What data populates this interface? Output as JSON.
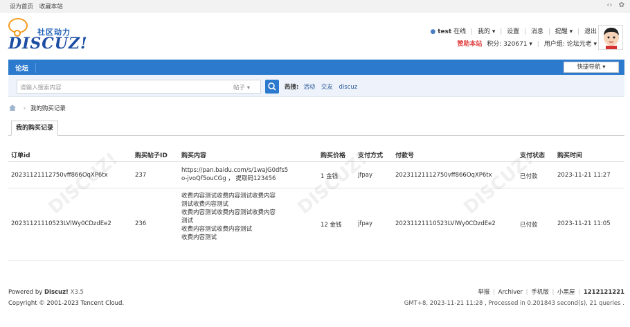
{
  "topbar": {
    "set_home": "设为首页",
    "bookmark": "收藏本站"
  },
  "logo": {
    "cn": "社区动力",
    "en": "DISCUZ!"
  },
  "user": {
    "name": "test",
    "online": "在线",
    "my": "我的",
    "settings": "设置",
    "messages": "消息",
    "reminders": "提醒",
    "logout": "退出",
    "sponsor": "赞助本站",
    "credits": "积分: 320671",
    "usergroup": "用户组: 论坛元老"
  },
  "nav": {
    "title": "论坛",
    "quick_nav": "快捷导航"
  },
  "search": {
    "placeholder": "请输入搜索内容",
    "type": "帖子",
    "hot_label": "热搜:",
    "hot_terms": [
      "活动",
      "交友",
      "discuz"
    ]
  },
  "breadcrumb": {
    "current": "我的购买记录"
  },
  "tab": {
    "label": "我的购买记录"
  },
  "table": {
    "headers": [
      "订单id",
      "购买帖子ID",
      "购买内容",
      "购买价格",
      "支付方式",
      "付款号",
      "支付状态",
      "购买时间"
    ],
    "rows": [
      {
        "order_id": "20231121112750vff866OqXP6tx",
        "post_id": "237",
        "content": [
          "https://pan.baidu.com/s/1waJG0dfs5",
          "o-jvoQf5ouCGg ， 提取码123456"
        ],
        "price": "1 金钱",
        "pay_method": "jfpay",
        "pay_no": "20231121112750vff866OqXP6tx",
        "status": "已付款",
        "time": "2023-11-21 11:27"
      },
      {
        "order_id": "20231121110523LVlWy0CDzdEe2",
        "post_id": "236",
        "content": [
          "收费内容测试收费内容测试收费内容",
          "测试收费内容测试",
          "收费内容测试收费内容测试收费内容",
          "测试",
          "收费内容测试收费内容测试",
          "收费内容测试"
        ],
        "price": "12 金钱",
        "pay_method": "jfpay",
        "pay_no": "20231121110523LVlWy0CDzdEe2",
        "status": "已付款",
        "time": "2023-11-21 11:05"
      }
    ]
  },
  "footer": {
    "powered_prefix": "Powered by",
    "powered_brand": "Discuz!",
    "version": "X3.5",
    "copyright": "Copyright © 2001-2023 Tencent Cloud.",
    "links": [
      "举报",
      "Archiver",
      "手机版",
      "小黑屋"
    ],
    "site_id": "1212121221",
    "stats": "GMT+8, 2023-11-21 11:28 , Processed in 0.201843 second(s), 21 queries ."
  },
  "colors": {
    "nav_blue": "#2b7acd",
    "logo_orange": "#f39b1c",
    "sponsor_red": "#e23c3c"
  }
}
